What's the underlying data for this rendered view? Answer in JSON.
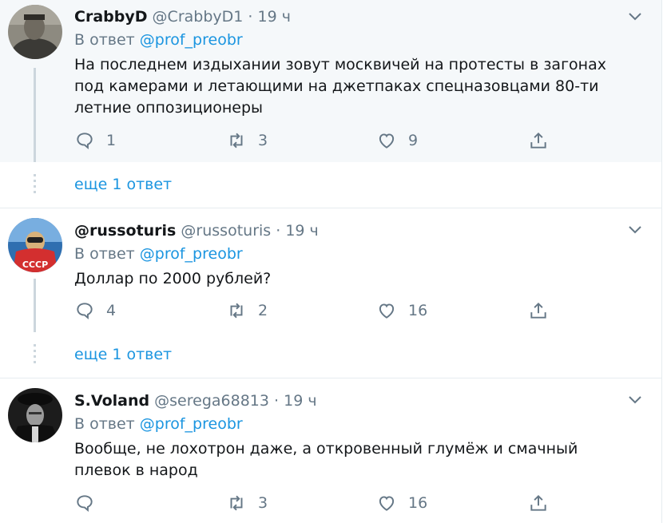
{
  "tweets": [
    {
      "name": "CrabbyD",
      "handle": "@CrabbyD1",
      "separator": "·",
      "time": "19 ч",
      "reply_prefix": "В ответ",
      "reply_to": "@prof_preobr",
      "text": "На последнем издыхании зовут москвичей на протесты в загонах под камерами и летающими на джетпаках спецназовцами 80-ти летние оппозиционеры",
      "replies": "1",
      "retweets": "3",
      "likes": "9"
    },
    {
      "name": "@russoturis",
      "handle": "@russoturis",
      "separator": "·",
      "time": "19 ч",
      "reply_prefix": "В ответ",
      "reply_to": "@prof_preobr",
      "text": "Доллар по 2000 рублей?",
      "replies": "4",
      "retweets": "2",
      "likes": "16"
    },
    {
      "name": "S.Voland",
      "handle": "@serega68813",
      "separator": "·",
      "time": "19 ч",
      "reply_prefix": "В ответ",
      "reply_to": "@prof_preobr",
      "text": "Вообще, не лохотрон даже, а откровенный глумёж и смачный плевок в народ",
      "replies": "",
      "retweets": "3",
      "likes": "16"
    }
  ],
  "more_replies": [
    "еще 1 ответ",
    "еще 1 ответ"
  ],
  "colors": {
    "link": "#1b95e0",
    "muted": "#657786",
    "highlight_bg": "#f5f8fa",
    "border": "#e6ecf0"
  },
  "icons": [
    "reply-icon",
    "retweet-icon",
    "like-icon",
    "share-icon",
    "chevron-down-icon"
  ]
}
